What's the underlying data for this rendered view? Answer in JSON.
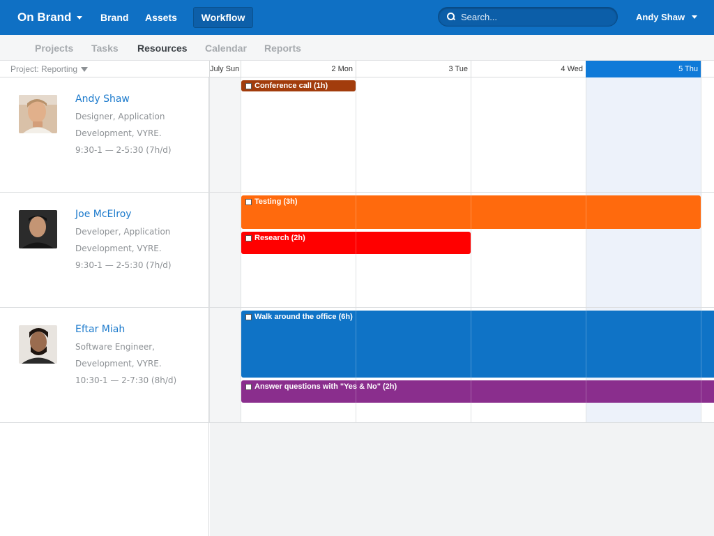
{
  "topbar": {
    "brand": "On Brand",
    "nav": [
      "Brand",
      "Assets"
    ],
    "active_nav": "Workflow",
    "search_placeholder": "Search...",
    "user": "Andy Shaw"
  },
  "subnav": {
    "tabs": [
      "Projects",
      "Tasks",
      "Resources",
      "Calendar",
      "Reports"
    ],
    "active": "Resources"
  },
  "calendar": {
    "project_filter": "Project: Reporting",
    "days": [
      "July Sun",
      "2 Mon",
      "3 Tue",
      "4 Wed",
      "5 Thu"
    ],
    "today": "5 Thu"
  },
  "people": [
    {
      "name": "Andy Shaw",
      "role_line1": "Designer, Application",
      "role_line2": "Development, VYRE.",
      "hours": "9:30-1 — 2-5:30 (7h/d)"
    },
    {
      "name": "Joe McElroy",
      "role_line1": "Developer, Application",
      "role_line2": "Development, VYRE.",
      "hours": "9:30-1 — 2-5:30 (7h/d)"
    },
    {
      "name": "Eftar Miah",
      "role_line1": "Software Engineer,",
      "role_line2": "Development, VYRE.",
      "hours": "10:30-1 — 2-7:30 (8h/d)"
    }
  ],
  "events": [
    {
      "label": "Conference call (1h)",
      "color": "#a23c0c"
    },
    {
      "label": "Testing (3h)",
      "color": "#ff6a0d"
    },
    {
      "label": "Research (2h)",
      "color": "#ff0000"
    },
    {
      "label": "Walk around the office (6h)",
      "color": "#0f73c6"
    },
    {
      "label": "Answer questions with \"Yes & No\" (2h)",
      "color": "#8a2e8d"
    }
  ]
}
